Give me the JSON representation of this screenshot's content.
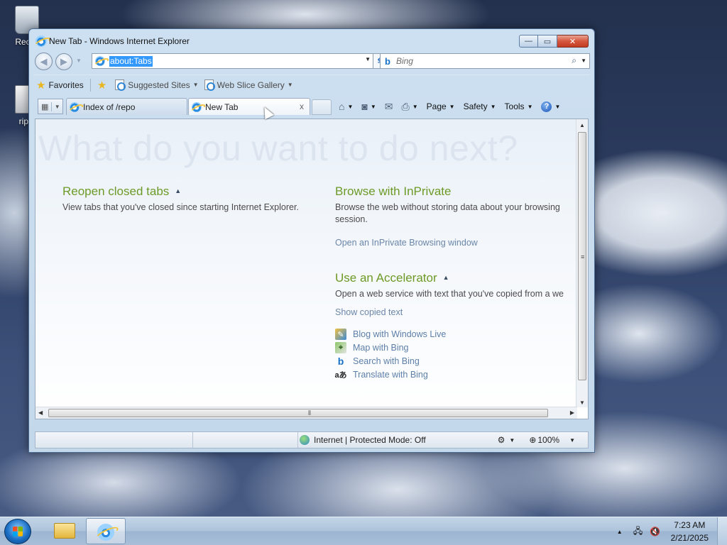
{
  "desktop": {
    "icons": [
      {
        "label": "Recyc",
        "icon": "recycle-bin-icon"
      },
      {
        "label": "rippl",
        "icon": "document-icon"
      }
    ]
  },
  "window": {
    "title": "New Tab - Windows Internet Explorer",
    "caption_buttons": {
      "minimize": "—",
      "maximize": "▭",
      "close": "✕"
    }
  },
  "navigation": {
    "back_glyph": "◀",
    "forward_glyph": "▶",
    "address": "about:Tabs",
    "refresh_glyph": "⇆",
    "stop_glyph": "✕",
    "search_placeholder": "Bing",
    "search_go_glyph": "⌕"
  },
  "favorites_bar": {
    "favorites_label": "Favorites",
    "items": [
      {
        "label": "Suggested Sites"
      },
      {
        "label": "Web Slice Gallery"
      }
    ]
  },
  "tabs": [
    {
      "label": "Index of /repo"
    },
    {
      "label": "New Tab",
      "close": "x"
    }
  ],
  "command_bar": {
    "page": "Page",
    "safety": "Safety",
    "tools": "Tools",
    "help": "?"
  },
  "content": {
    "headline": "What do you want to do next?",
    "reopen": {
      "title": "Reopen closed tabs",
      "desc": "View tabs that you've closed since starting Internet Explorer."
    },
    "inprivate": {
      "title": "Browse with InPrivate",
      "desc_line1": "Browse the web without storing data about your browsing",
      "desc_line2": "session.",
      "link": "Open an InPrivate Browsing window"
    },
    "accelerator": {
      "title": "Use an Accelerator",
      "desc": "Open a web service with text that you've copied from a we",
      "show_copied": "Show copied text",
      "items": [
        {
          "label": "Blog with Windows Live",
          "icon": "blog-icon"
        },
        {
          "label": "Map with Bing",
          "icon": "map-icon"
        },
        {
          "label": "Search with Bing",
          "icon": "bing-icon"
        },
        {
          "label": "Translate with Bing",
          "icon": "translate-icon"
        }
      ]
    },
    "collapse_glyph": "▲"
  },
  "status_bar": {
    "zone": "Internet | Protected Mode: Off",
    "zoom": "100%"
  },
  "taskbar": {
    "time": "7:23 AM",
    "date": "2/21/2025"
  },
  "colors": {
    "section_title": "#6d9a27",
    "link": "#6a86a8",
    "selection": "#3399ff"
  }
}
